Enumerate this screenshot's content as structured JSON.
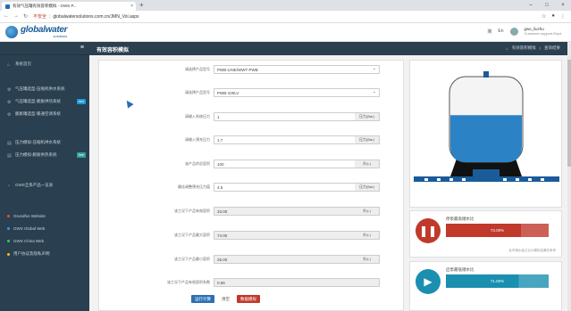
{
  "browser": {
    "tab_title": "有效气压罐有效容积模拟 - GWS P...",
    "tab_close": "×",
    "new_tab": "+",
    "window_controls": [
      "–",
      "□",
      "×"
    ],
    "nav": [
      "←",
      "→",
      "↻"
    ],
    "security": "不安全",
    "url": "globalwatersolutions.com.cn/JMN_Vol.aspx",
    "addr_icons": [
      "☆",
      "●",
      "⋮"
    ]
  },
  "header": {
    "brand": "globalwater",
    "brand_sub": "solutions",
    "lang": "简",
    "lang2": "En",
    "user_name": "gws_liuzhu",
    "user_role": "Customer support Dept."
  },
  "sidebar": {
    "menu_icon": "≡",
    "items": [
      {
        "label": "系统首页",
        "icon": "home-icon",
        "glyph": "⌂",
        "badge": ""
      },
      {
        "label": "气压罐选型-压缩机供水系统",
        "icon": "gear-icon",
        "glyph": "⚙",
        "badge": ""
      },
      {
        "label": "气压罐选型-膨胀供热系统",
        "icon": "gear-icon",
        "glyph": "⚙",
        "badge": "new"
      },
      {
        "label": "膨胀罐选型-暖通空调系统",
        "icon": "gear-icon",
        "glyph": "⚙",
        "badge": ""
      },
      {
        "label": "压力模拟-压缩机供水系统",
        "icon": "chart-icon",
        "glyph": "▤",
        "badge": ""
      },
      {
        "label": "压力模拟-膨胀供热系统",
        "icon": "chart-icon",
        "glyph": "▤",
        "badge": "free"
      },
      {
        "label": "GWS全系产品一览表",
        "icon": "list-icon",
        "glyph": "◔",
        "badge": ""
      }
    ],
    "links": [
      {
        "label": "Grundfos Website",
        "color": "#e74c3c"
      },
      {
        "label": "GWS Global Web",
        "color": "#3498db"
      },
      {
        "label": "GWS China Web",
        "color": "#2ecc71"
      },
      {
        "label": "用户协议及隐私声明",
        "color": "#f1c40f"
      }
    ]
  },
  "page": {
    "title": "有效容积模拟",
    "breadcrumb": [
      "⌂",
      "有效容积模拟",
      "/",
      "查询结果"
    ]
  },
  "form": {
    "fields": [
      {
        "label": "请选择产品型号",
        "value": "PWB-LINE/WWT-PWB",
        "type": "select",
        "unit": ""
      },
      {
        "label": "请选择产品型号",
        "value": "PWB-100LV",
        "type": "select",
        "unit": ""
      },
      {
        "label": "请输入系统压力",
        "value": "1",
        "type": "input",
        "unit": "压力(Bar)"
      },
      {
        "label": "请输入预充压力",
        "value": "1.7",
        "type": "input",
        "unit": "压力(Bar)"
      },
      {
        "label": "该产品的总容积",
        "value": "100",
        "type": "input",
        "unit": "升(L)"
      },
      {
        "label": "最佳调整预充压力值",
        "value": "4.5",
        "type": "input",
        "unit": "压力(Bar)"
      },
      {
        "label": "该工况下产品有效容积",
        "value": "33.00",
        "type": "grey",
        "unit": "升(L)"
      },
      {
        "label": "该工况下产品最大容积",
        "value": "74.00",
        "type": "grey",
        "unit": "升(L)"
      },
      {
        "label": "该工况下产品最小容积",
        "value": "25.00",
        "type": "grey",
        "unit": "升(L)"
      },
      {
        "label": "该工况下产品有效容积系数",
        "value": "0.66",
        "type": "grey",
        "unit": ""
      }
    ],
    "buttons": [
      {
        "label": "运行计算",
        "color": "#2c6fb5"
      },
      {
        "label": "清空",
        "color": ""
      },
      {
        "label": "数据模拟",
        "color": "#c0392b"
      }
    ]
  },
  "volume_cards": [
    {
      "title": "停泵最高储水比",
      "value": "73.00%",
      "fill": 0.73,
      "color": "#c0392b",
      "glyph": "❚❚",
      "note": "此时储水量占比为模拟结果的参考"
    },
    {
      "title": "启泵最低储水比",
      "value": "71.00%",
      "fill": 0.71,
      "color": "#1a8fb0",
      "glyph": "▶",
      "note": ""
    }
  ],
  "tank": {
    "water_level": 0.55
  }
}
